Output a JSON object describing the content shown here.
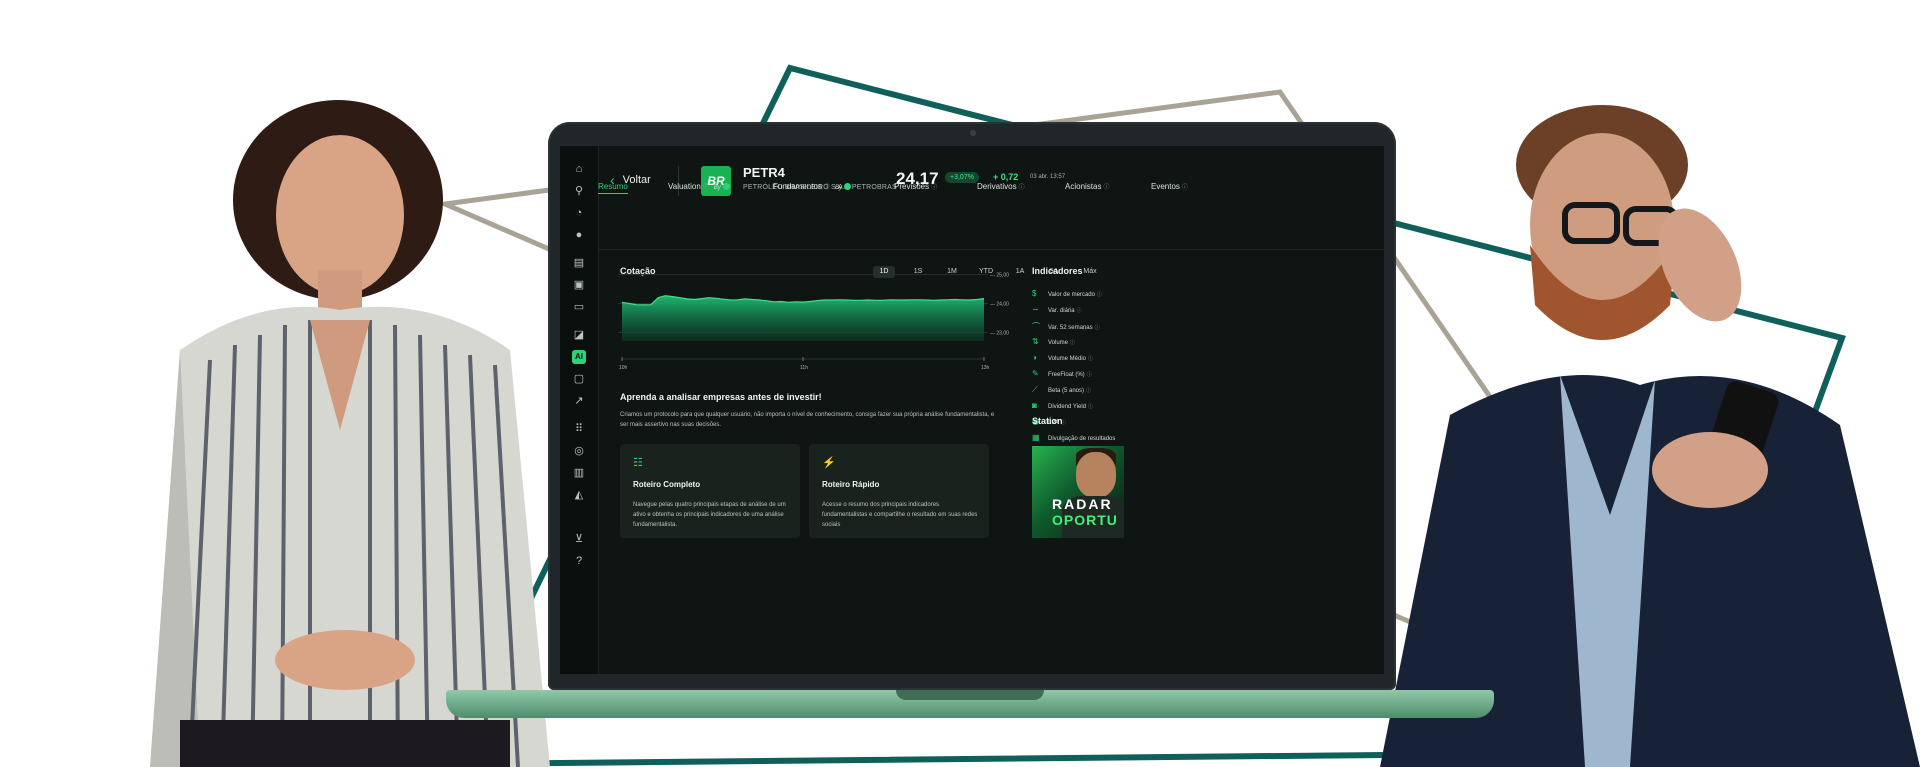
{
  "colors": {
    "accent": "#2dd27a",
    "screen_bg": "#0e1512",
    "teal_line": "#0f5f5a",
    "gray_line": "#a9a395"
  },
  "sidebar": {
    "icons": [
      "home-icon",
      "rocket-icon",
      "compass-icon",
      "globe-icon",
      "document-icon",
      "bank-icon",
      "calendar-icon",
      "tradingview-icon",
      "ai-icon",
      "wallet-icon",
      "chart-icon",
      "apps-icon",
      "target-icon",
      "report-icon",
      "education-icon",
      "cart-icon",
      "help-icon"
    ],
    "active_label": "AI"
  },
  "header": {
    "back_label": "Voltar",
    "logo_text": "BR",
    "ticker": "PETR4",
    "company": "PETRÓLEO BRASILEIRO S.A. - PETROBRAS",
    "price": "24,17",
    "pct_change": "+3,07%",
    "abs_change": "+ 0,72",
    "datetime": "03 abr. 13:57"
  },
  "tabs": [
    {
      "label": "Resumo",
      "active": true
    },
    {
      "label": "Valuation",
      "by": "By"
    },
    {
      "label": "Fundamentos",
      "by": "By"
    },
    {
      "label": "Previsões"
    },
    {
      "label": "Derivativos"
    },
    {
      "label": "Acionistas"
    },
    {
      "label": "Eventos"
    }
  ],
  "quote": {
    "title": "Cotação",
    "periods": [
      "1D",
      "1S",
      "1M",
      "YTD",
      "1A",
      "5A",
      "Máx"
    ],
    "active_period": "1D"
  },
  "chart_data": {
    "type": "area",
    "title": "Cotação",
    "x_tick_labels": [
      "10h",
      "11h",
      "13h"
    ],
    "y_tick_labels": [
      "25,00",
      "24,00",
      "23,00"
    ],
    "ylim": [
      22.7,
      25.3
    ],
    "grid": true,
    "legend": "none",
    "x": [
      0,
      0.02,
      0.04,
      0.06,
      0.08,
      0.1,
      0.12,
      0.14,
      0.16,
      0.18,
      0.2,
      0.22,
      0.24,
      0.26,
      0.28,
      0.3,
      0.32,
      0.34,
      0.36,
      0.38,
      0.4,
      0.42,
      0.44,
      0.46,
      0.48,
      0.5,
      0.52,
      0.54,
      0.56,
      0.58,
      0.6,
      0.62,
      0.64,
      0.66,
      0.68,
      0.7,
      0.72,
      0.74,
      0.76,
      0.78,
      0.8,
      0.82,
      0.84,
      0.86,
      0.88,
      0.9,
      0.92,
      0.94,
      0.96,
      0.98,
      1.0
    ],
    "values": [
      24.04,
      24.0,
      23.96,
      23.95,
      23.96,
      24.2,
      24.27,
      24.24,
      24.2,
      24.16,
      24.14,
      24.17,
      24.2,
      24.18,
      24.15,
      24.12,
      24.13,
      24.16,
      24.14,
      24.12,
      24.09,
      24.06,
      24.07,
      24.04,
      24.06,
      24.05,
      24.07,
      24.1,
      24.12,
      24.12,
      24.13,
      24.12,
      24.11,
      24.11,
      24.12,
      24.11,
      24.11,
      24.13,
      24.12,
      24.12,
      24.13,
      24.13,
      24.12,
      24.11,
      24.12,
      24.13,
      24.14,
      24.13,
      24.12,
      24.14,
      24.17
    ]
  },
  "learn": {
    "title": "Aprenda a analisar empresas antes de investir!",
    "text": "Criamos um protocolo para que qualquer usuário, não importa o nível de conhecimento, consiga fazer sua própria análise fundamentalista, e ser mais assertivo nas suas decisões.",
    "cards": [
      {
        "icon": "checklist-icon",
        "title": "Roteiro Completo",
        "desc": "Navegue pelas quatro principais etapas de análise de um ativo e obtenha os principais indicadores de uma análise fundamentalista."
      },
      {
        "icon": "lightning-icon",
        "title": "Roteiro Rápido",
        "desc": "Acesse o resumo dos principais indicadores fundamentalistas e compartilhe o resultado em suas redes sociais"
      }
    ]
  },
  "indicators": {
    "title": "Indicadores",
    "items": [
      {
        "label": "Valor de mercado",
        "icon": "dollar-icon"
      },
      {
        "label": "Var. diária",
        "icon": "trend-icon"
      },
      {
        "label": "Var. 52 semanas",
        "icon": "trend-area-icon"
      },
      {
        "label": "Volume",
        "icon": "volume-icon"
      },
      {
        "label": "Volume Médio",
        "icon": "volume-avg-icon"
      },
      {
        "label": "FreeFloat (%)",
        "icon": "freefloat-icon"
      },
      {
        "label": "Beta (5 anos)",
        "icon": "beta-icon"
      },
      {
        "label": "Dividend Yield",
        "icon": "dividend-icon"
      },
      {
        "label": "LPA",
        "icon": "lpa-icon"
      },
      {
        "label": "Divulgação de resultados",
        "icon": "results-icon"
      }
    ]
  },
  "station": {
    "title": "Station",
    "banner_line1": "RADAR",
    "banner_line2": "OPORTU"
  }
}
